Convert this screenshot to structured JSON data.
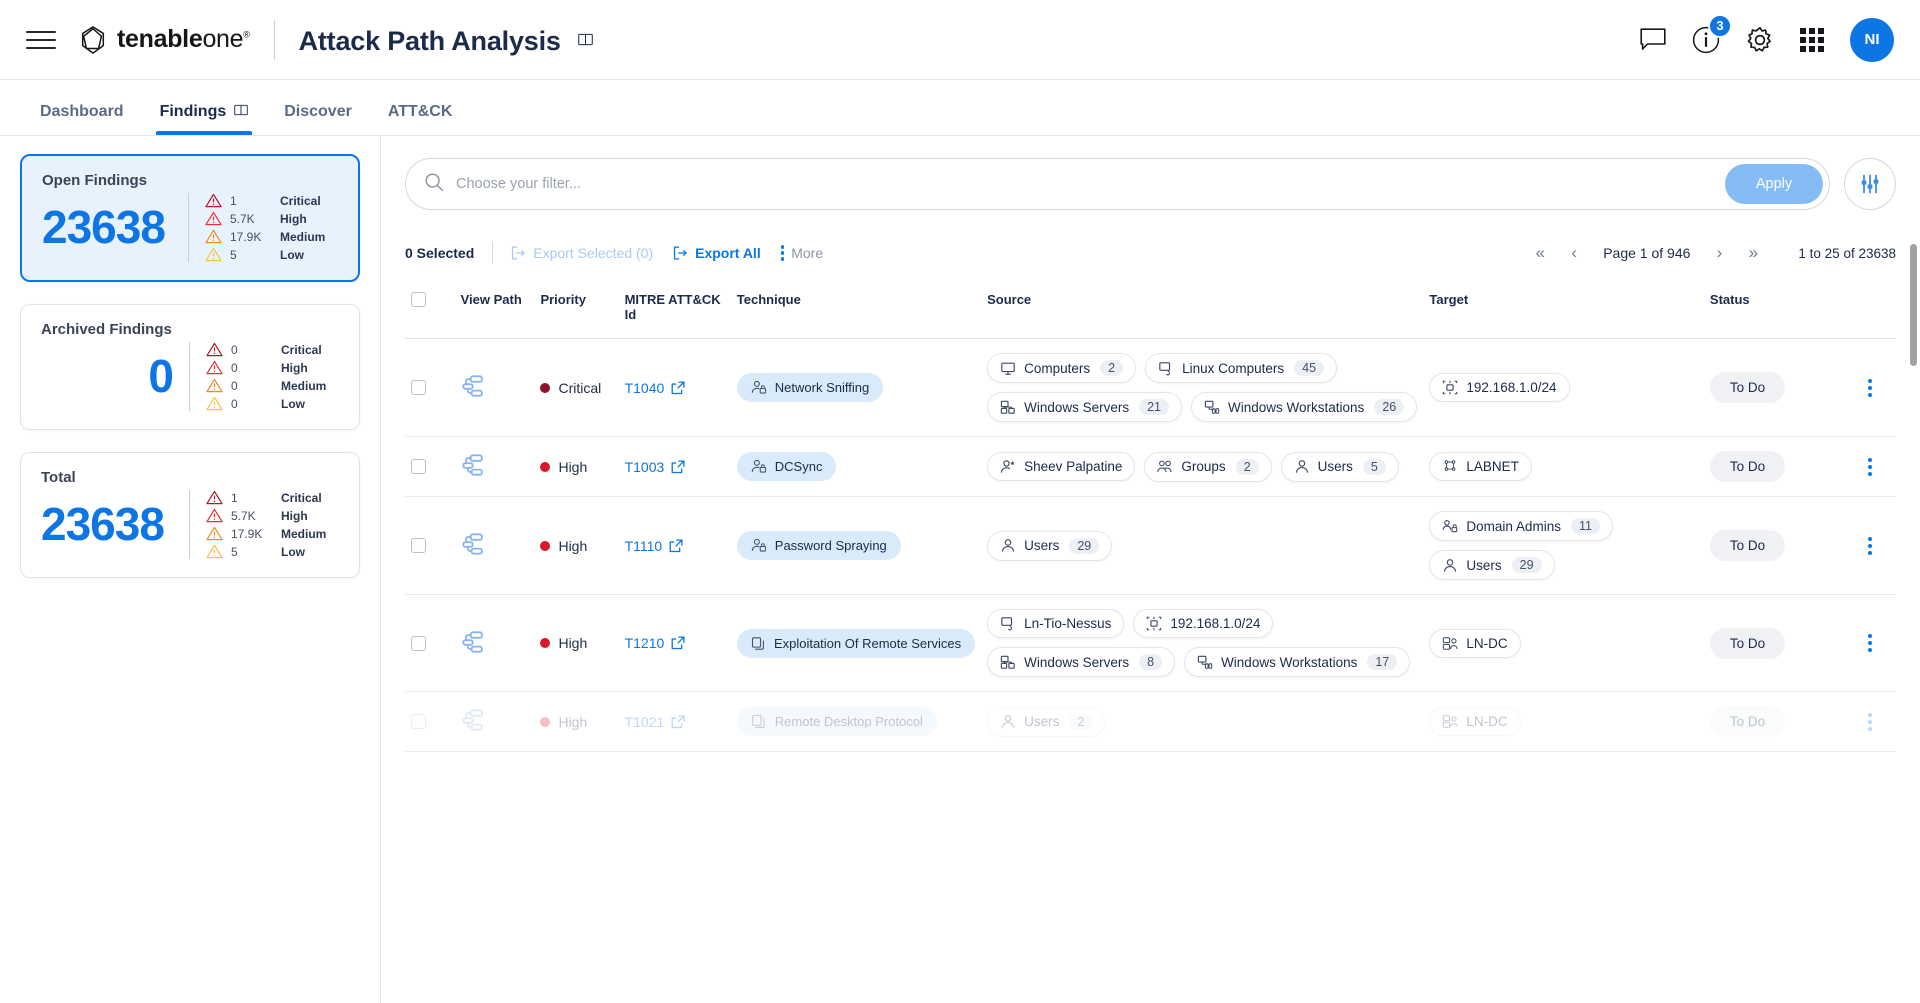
{
  "header": {
    "menu_icon": "hamburger-icon",
    "brand_bold": "tenable",
    "brand_light": "one",
    "brand_tm": "®",
    "title": "Attack Path Analysis",
    "title_doc_icon": "book-icon",
    "icons": {
      "chat": "chat-bubble-icon",
      "info": "info-circle-icon",
      "gear": "gear-icon",
      "apps": "apps-grid-icon"
    },
    "notification_count": "3",
    "avatar_initials": "NI"
  },
  "tabs": [
    {
      "label": "Dashboard",
      "active": false,
      "has_doc_icon": false
    },
    {
      "label": "Findings",
      "active": true,
      "has_doc_icon": true
    },
    {
      "label": "Discover",
      "active": false,
      "has_doc_icon": false
    },
    {
      "label": "ATT&CK",
      "active": false,
      "has_doc_icon": false
    }
  ],
  "sidebar": {
    "cards": [
      {
        "title": "Open Findings",
        "total": "23638",
        "selected": true,
        "num_align": "left",
        "severities": [
          {
            "count": "1",
            "label": "Critical",
            "color": "#b0182b"
          },
          {
            "count": "5.7K",
            "label": "High",
            "color": "#e8313a"
          },
          {
            "count": "17.9K",
            "label": "Medium",
            "color": "#f08a25"
          },
          {
            "count": "5",
            "label": "Low",
            "color": "#f6c440"
          }
        ]
      },
      {
        "title": "Archived Findings",
        "total": "0",
        "selected": false,
        "num_align": "right",
        "severities": [
          {
            "count": "0",
            "label": "Critical",
            "color": "#b0182b"
          },
          {
            "count": "0",
            "label": "High",
            "color": "#e8313a"
          },
          {
            "count": "0",
            "label": "Medium",
            "color": "#f08a25"
          },
          {
            "count": "0",
            "label": "Low",
            "color": "#f6c440"
          }
        ]
      },
      {
        "title": "Total",
        "total": "23638",
        "selected": false,
        "num_align": "left",
        "severities": [
          {
            "count": "1",
            "label": "Critical",
            "color": "#b0182b"
          },
          {
            "count": "5.7K",
            "label": "High",
            "color": "#e8313a"
          },
          {
            "count": "17.9K",
            "label": "Medium",
            "color": "#f08a25"
          },
          {
            "count": "5",
            "label": "Low",
            "color": "#f6c440"
          }
        ]
      }
    ]
  },
  "filter": {
    "placeholder": "Choose your filter...",
    "value": "",
    "search_icon": "search-icon",
    "apply_label": "Apply",
    "settings_icon": "sliders-icon"
  },
  "toolbar": {
    "selected_label": "0 Selected",
    "export_selected_label": "Export Selected (0)",
    "export_all_label": "Export All",
    "more_label": "More",
    "pager": {
      "first": "«",
      "prev": "‹",
      "page_label": "Page 1 of 946",
      "next": "›",
      "last": "»",
      "range_label": "1 to 25 of 23638"
    }
  },
  "table": {
    "columns": [
      {
        "key": "check",
        "label": ""
      },
      {
        "key": "view",
        "label": "View Path"
      },
      {
        "key": "pri",
        "label": "Priority"
      },
      {
        "key": "mitre",
        "label": "MITRE ATT&CK Id"
      },
      {
        "key": "tech",
        "label": "Technique"
      },
      {
        "key": "source",
        "label": "Source"
      },
      {
        "key": "target",
        "label": "Target"
      },
      {
        "key": "status",
        "label": "Status"
      },
      {
        "key": "act",
        "label": ""
      }
    ],
    "rows": [
      {
        "priority": "Critical",
        "priority_color": "#8f1228",
        "mitre_id": "T1040",
        "technique": "Network Sniffing",
        "technique_icon": "user-network-icon",
        "source": [
          {
            "label": "Computers",
            "count": "2",
            "icon": "monitor-icon"
          },
          {
            "label": "Linux Computers",
            "count": "45",
            "icon": "linux-computer-icon"
          },
          {
            "label": "Windows Servers",
            "count": "21",
            "icon": "server-icon"
          },
          {
            "label": "Windows Workstations",
            "count": "26",
            "icon": "workstation-icon"
          }
        ],
        "target": [
          {
            "label": "192.168.1.0/24",
            "count": "",
            "icon": "subnet-icon"
          }
        ],
        "status": "To Do"
      },
      {
        "priority": "High",
        "priority_color": "#d9182b",
        "mitre_id": "T1003",
        "technique": "DCSync",
        "technique_icon": "user-network-icon",
        "source": [
          {
            "label": "Sheev Palpatine",
            "count": "",
            "icon": "user-star-icon"
          },
          {
            "label": "Groups",
            "count": "2",
            "icon": "group-icon"
          },
          {
            "label": "Users",
            "count": "5",
            "icon": "user-icon"
          }
        ],
        "target": [
          {
            "label": "LABNET",
            "count": "",
            "icon": "domain-icon"
          }
        ],
        "status": "To Do"
      },
      {
        "priority": "High",
        "priority_color": "#d9182b",
        "mitre_id": "T1110",
        "technique": "Password Spraying",
        "technique_icon": "user-network-icon",
        "source": [
          {
            "label": "Users",
            "count": "29",
            "icon": "user-icon"
          }
        ],
        "target": [
          {
            "label": "Domain Admins",
            "count": "11",
            "icon": "admin-group-icon"
          },
          {
            "label": "Users",
            "count": "29",
            "icon": "user-icon"
          }
        ],
        "status": "To Do"
      },
      {
        "priority": "High",
        "priority_color": "#d9182b",
        "mitre_id": "T1210",
        "technique": "Exploitation Of Remote Services",
        "technique_icon": "copy-icon",
        "source": [
          {
            "label": "Ln-Tio-Nessus",
            "count": "",
            "icon": "linux-computer-icon"
          },
          {
            "label": "192.168.1.0/24",
            "count": "",
            "icon": "subnet-icon"
          },
          {
            "label": "Windows Servers",
            "count": "8",
            "icon": "server-icon"
          },
          {
            "label": "Windows Workstations",
            "count": "17",
            "icon": "workstation-icon"
          }
        ],
        "target": [
          {
            "label": "LN-DC",
            "count": "",
            "icon": "dc-icon"
          }
        ],
        "status": "To Do"
      },
      {
        "priority": "High",
        "priority_color": "#d9182b",
        "mitre_id": "T1021",
        "technique": "Remote Desktop Protocol",
        "technique_icon": "copy-icon",
        "source": [
          {
            "label": "Users",
            "count": "2",
            "icon": "user-icon"
          }
        ],
        "target": [
          {
            "label": "LN-DC",
            "count": "",
            "icon": "dc-icon"
          }
        ],
        "status": "To Do",
        "faded": true
      }
    ]
  }
}
